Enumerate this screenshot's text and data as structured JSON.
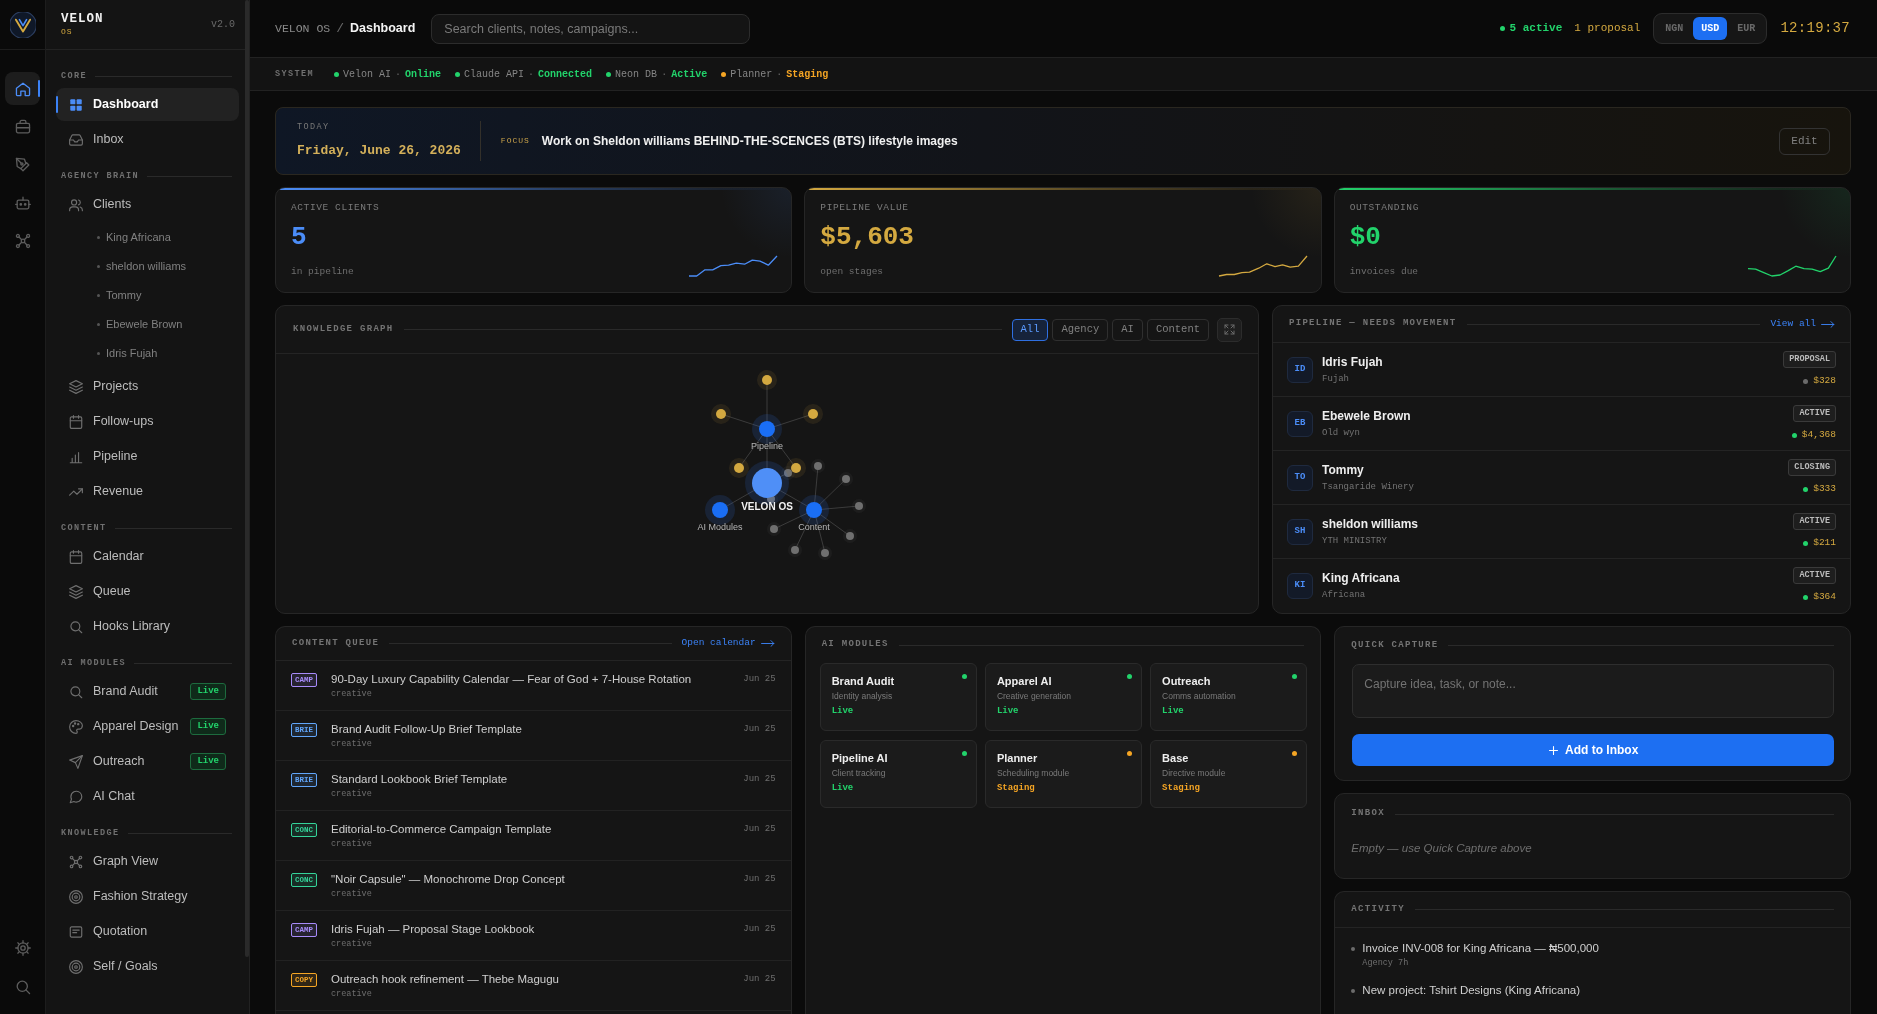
{
  "brand": {
    "name": "VELON",
    "subtitle": "OS",
    "version": "v2.0"
  },
  "rail": [
    {
      "selected": true
    },
    {
      "selected": false
    },
    {
      "selected": false
    },
    {
      "selected": false
    },
    {
      "selected": false
    }
  ],
  "sidebar": {
    "sections": [
      {
        "title": "CORE",
        "items": [
          {
            "label": "Dashboard",
            "selected": true
          },
          {
            "label": "Inbox",
            "selected": false
          }
        ]
      },
      {
        "title": "AGENCY BRAIN",
        "items": [
          {
            "label": "Clients",
            "selected": false,
            "children": [
              {
                "label": "King Africana",
                "selected": false
              },
              {
                "label": "sheldon williams",
                "selected": false
              },
              {
                "label": "Tommy",
                "selected": false
              },
              {
                "label": "Ebewele Brown",
                "selected": false
              },
              {
                "label": "Idris Fujah",
                "selected": false
              }
            ]
          },
          {
            "label": "Projects",
            "selected": false
          },
          {
            "label": "Follow-ups",
            "selected": false
          },
          {
            "label": "Pipeline",
            "selected": false
          },
          {
            "label": "Revenue",
            "selected": false
          }
        ]
      },
      {
        "title": "CONTENT",
        "items": [
          {
            "label": "Calendar",
            "selected": false
          },
          {
            "label": "Queue",
            "selected": false
          },
          {
            "label": "Hooks Library",
            "selected": false
          }
        ]
      },
      {
        "title": "AI MODULES",
        "items": [
          {
            "label": "Brand Audit",
            "selected": false,
            "badge": "Live"
          },
          {
            "label": "Apparel Design",
            "selected": false,
            "badge": "Live"
          },
          {
            "label": "Outreach",
            "selected": false,
            "badge": "Live"
          },
          {
            "label": "AI Chat",
            "selected": false
          }
        ]
      },
      {
        "title": "KNOWLEDGE",
        "items": [
          {
            "label": "Graph View",
            "selected": false
          },
          {
            "label": "Fashion Strategy",
            "selected": false
          },
          {
            "label": "Quotation",
            "selected": false
          },
          {
            "label": "Self / Goals",
            "selected": false
          }
        ]
      }
    ]
  },
  "topbar": {
    "breadcrumb": [
      "VELON OS",
      "Dashboard"
    ],
    "separator": "/",
    "search": {
      "placeholder": "Search clients, notes, campaigns..."
    },
    "active": "5 active",
    "proposals": "1 proposal",
    "currencies": [
      {
        "label": "NGN",
        "selected": false
      },
      {
        "label": "USD",
        "selected": true
      },
      {
        "label": "EUR",
        "selected": false
      }
    ],
    "clock": "12:19:37"
  },
  "system": {
    "label": "SYSTEM",
    "separator": "·",
    "services": [
      {
        "name": "Velon AI",
        "status": "Online",
        "color": "#22d36b"
      },
      {
        "name": "Claude API",
        "status": "Connected",
        "color": "#22d36b"
      },
      {
        "name": "Neon DB",
        "status": "Active",
        "color": "#22d36b"
      },
      {
        "name": "Planner",
        "status": "Staging",
        "color": "#f5a524"
      }
    ]
  },
  "today": {
    "label": "TODAY",
    "date": "Friday, June 26, 2026",
    "focus_label": "FOCUS",
    "focus": "Work on Sheldon williams BEHIND-THE-SCENCES (BTS) lifestyle images",
    "edit": "Edit"
  },
  "kpis": [
    {
      "label": "ACTIVE CLIENTS",
      "value": "5",
      "note": "in pipeline",
      "color": "#4b8df8"
    },
    {
      "label": "PIPELINE VALUE",
      "value": "$5,603",
      "note": "open stages",
      "color": "#d4a940"
    },
    {
      "label": "OUTSTANDING",
      "value": "$0",
      "note": "invoices due",
      "color": "#22d36b"
    }
  ],
  "knowledge_graph": {
    "title": "KNOWLEDGE GRAPH",
    "filters": [
      {
        "label": "All",
        "selected": true
      },
      {
        "label": "Agency",
        "selected": false
      },
      {
        "label": "AI",
        "selected": false
      },
      {
        "label": "Content",
        "selected": false
      }
    ],
    "nodes": [
      {
        "label": "VELON OS",
        "kind": "hub"
      },
      {
        "label": "Pipeline",
        "kind": "branch"
      },
      {
        "label": "AI Modules",
        "kind": "branch"
      },
      {
        "label": "Content",
        "kind": "branch"
      }
    ]
  },
  "pipeline": {
    "title": "PIPELINE — NEEDS MOVEMENT",
    "link": "View all",
    "rows": [
      {
        "initials": "ID",
        "name": "Idris Fujah",
        "company": "Fujah",
        "stage": "PROPOSAL",
        "amount": "$328",
        "color": "#6b6b6b"
      },
      {
        "initials": "EB",
        "name": "Ebewele Brown",
        "company": "Old wyn",
        "stage": "ACTIVE",
        "amount": "$4,368",
        "color": "#22d36b"
      },
      {
        "initials": "TO",
        "name": "Tommy",
        "company": "Tsangaride Winery",
        "stage": "CLOSING",
        "amount": "$333",
        "color": "#22d36b"
      },
      {
        "initials": "SH",
        "name": "sheldon williams",
        "company": "YTH MINISTRY",
        "stage": "ACTIVE",
        "amount": "$211",
        "color": "#22d36b"
      },
      {
        "initials": "KI",
        "name": "King Africana",
        "company": "Africana",
        "stage": "ACTIVE",
        "amount": "$364",
        "color": "#22d36b"
      }
    ]
  },
  "content_queue": {
    "title": "CONTENT QUEUE",
    "link": "Open calendar",
    "items": [
      {
        "tag": "CAMP",
        "color": "#a78bfa",
        "title": "90-Day Luxury Capability Calendar — Fear of God + 7-House Rotation",
        "category": "creative",
        "date": "Jun 25"
      },
      {
        "tag": "BRIE",
        "color": "#60a5fa",
        "title": "Brand Audit Follow-Up Brief Template",
        "category": "creative",
        "date": "Jun 25"
      },
      {
        "tag": "BRIE",
        "color": "#60a5fa",
        "title": "Standard Lookbook Brief Template",
        "category": "creative",
        "date": "Jun 25"
      },
      {
        "tag": "CONC",
        "color": "#34d399",
        "title": "Editorial-to-Commerce Campaign Template",
        "category": "creative",
        "date": "Jun 25"
      },
      {
        "tag": "CONC",
        "color": "#34d399",
        "title": "\"Noir Capsule\" — Monochrome Drop Concept",
        "category": "creative",
        "date": "Jun 25"
      },
      {
        "tag": "CAMP",
        "color": "#a78bfa",
        "title": "Idris Fujah — Proposal Stage Lookbook",
        "category": "creative",
        "date": "Jun 25"
      },
      {
        "tag": "COPY",
        "color": "#f5a524",
        "title": "Outreach hook refinement — Thebe Magugu",
        "category": "creative",
        "date": "Jun 25"
      }
    ]
  },
  "ai_modules": {
    "title": "AI MODULES",
    "modules": [
      {
        "name": "Brand Audit",
        "description": "Identity analysis",
        "status": "Live",
        "color": "#22d36b"
      },
      {
        "name": "Apparel AI",
        "description": "Creative generation",
        "status": "Live",
        "color": "#22d36b"
      },
      {
        "name": "Outreach",
        "description": "Comms automation",
        "status": "Live",
        "color": "#22d36b"
      },
      {
        "name": "Pipeline AI",
        "description": "Client tracking",
        "status": "Live",
        "color": "#22d36b"
      },
      {
        "name": "Planner",
        "description": "Scheduling module",
        "status": "Staging",
        "color": "#f5a524"
      },
      {
        "name": "Base",
        "description": "Directive module",
        "status": "Staging",
        "color": "#f5a524"
      }
    ]
  },
  "quick_capture": {
    "title": "QUICK CAPTURE",
    "placeholder": "Capture idea, task, or note...",
    "button": "Add to Inbox"
  },
  "inbox": {
    "title": "INBOX",
    "empty": "Empty — use Quick Capture above"
  },
  "activity": {
    "title": "ACTIVITY",
    "items": [
      {
        "text": "Invoice INV-008 for King Africana — ₦500,000",
        "meta": "Agency 7h"
      },
      {
        "text": "New project: Tshirt Designs (King Africana)"
      }
    ]
  }
}
